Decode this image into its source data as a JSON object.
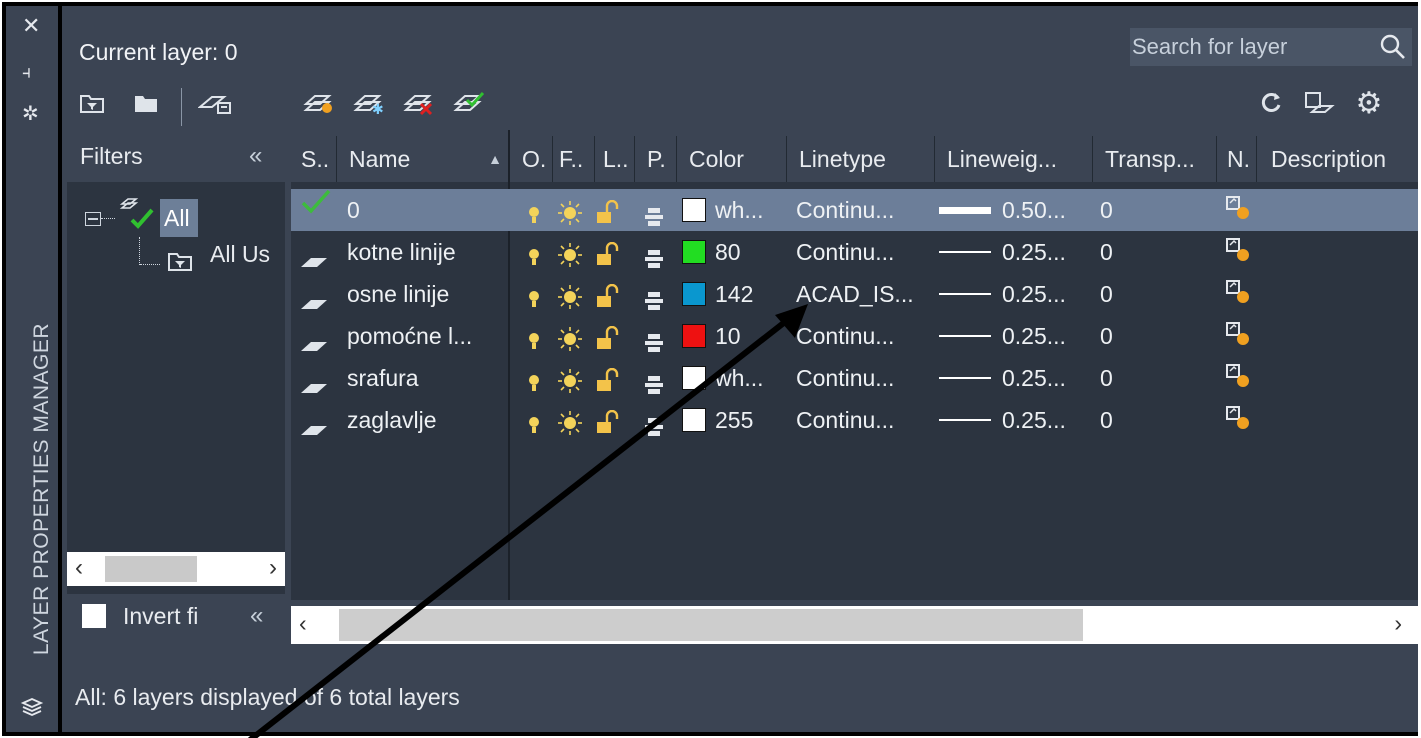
{
  "window": {
    "palette_title": "LAYER PROPERTIES MANAGER",
    "current_layer": "Current layer: 0",
    "search_placeholder": "Search for layer"
  },
  "strip_icons": [
    "close-icon",
    "pin-icon",
    "properties-icon",
    "layers-stack-icon"
  ],
  "toolbar_left": [
    "new-property-filter-icon",
    "new-group-filter-icon",
    "layer-states-manager-icon"
  ],
  "toolbar_layer": [
    "new-layer-icon",
    "new-layer-vp-frozen-icon",
    "delete-layer-icon",
    "set-current-icon"
  ],
  "toolbar_right": [
    "refresh-icon",
    "layer-settings-icon",
    "gear-icon"
  ],
  "filters": {
    "header": "Filters",
    "collapse_glyph": "«",
    "tree": [
      {
        "label": "All",
        "selected": true
      },
      {
        "label": "All Us"
      }
    ],
    "invert_label": "Invert fi",
    "invert_checked": false
  },
  "columns": [
    "S..",
    "Name",
    "O.",
    "F..",
    "L..",
    "P.",
    "Color",
    "Linetype",
    "Lineweig...",
    "Transp...",
    "N.",
    "Description"
  ],
  "layers": [
    {
      "name": "0",
      "current": true,
      "color_hex": "#ffffff",
      "color": "wh...",
      "linetype": "Continu...",
      "lineweight": "0.50...",
      "lw_heavy": true,
      "transparency": "0"
    },
    {
      "name": "kotne linije",
      "color_hex": "#22dd22",
      "color": "80",
      "linetype": "Continu...",
      "lineweight": "0.25...",
      "transparency": "0"
    },
    {
      "name": "osne linije",
      "color_hex": "#0a97cf",
      "color": "142",
      "linetype": "ACAD_IS...",
      "lineweight": "0.25...",
      "transparency": "0"
    },
    {
      "name": "pomoćne l...",
      "color_hex": "#ee1111",
      "color": "10",
      "linetype": "Continu...",
      "lineweight": "0.25...",
      "transparency": "0"
    },
    {
      "name": "srafura",
      "color_hex": "#ffffff",
      "color": "wh...",
      "linetype": "Continu...",
      "lineweight": "0.25...",
      "transparency": "0"
    },
    {
      "name": "zaglavlje",
      "color_hex": "#ffffff",
      "color": "255",
      "linetype": "Continu...",
      "lineweight": "0.25...",
      "transparency": "0"
    }
  ],
  "status": "All: 6 layers displayed of 6 total layers",
  "colors": {
    "panel": "#3b4453",
    "list": "#2c3440",
    "selection": "#6c7e99"
  }
}
